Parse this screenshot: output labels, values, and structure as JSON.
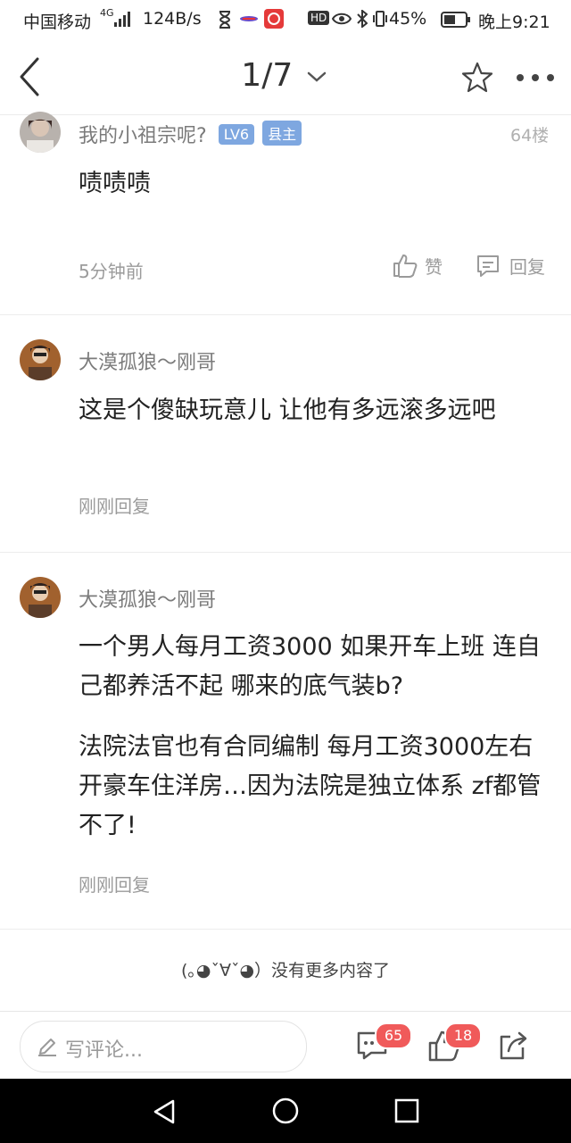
{
  "status_bar": {
    "carrier": "中国移动",
    "network_type": "4G",
    "speed": "124B/s",
    "battery_percent": "45%",
    "time": "晚上9:21",
    "hd_label": "HD"
  },
  "header": {
    "page_indicator": "1/7"
  },
  "posts": [
    {
      "username": "我的小祖宗呢?",
      "level_tag": "LV6",
      "role_tag": "县主",
      "floor": "64楼",
      "content": "啧啧啧",
      "time": "5分钟前",
      "like_label": "赞",
      "reply_label": "回复"
    },
    {
      "username": "大漠孤狼～刚哥",
      "content": "这是个傻缺玩意儿 让他有多远滚多远吧",
      "time": "刚刚回复"
    },
    {
      "username": "大漠孤狼～刚哥",
      "content": "一个男人每月工资3000 如果开车上班 连自己都养活不起 哪来的底气装b?",
      "content2": "法院法官也有合同编制 每月工资3000左右开豪车住洋房…因为法院是独立体系 zf都管不了!",
      "time": "刚刚回复"
    }
  ],
  "end_text": "(｡◕ˇ∀ˇ◕）没有更多内容了",
  "bottom_bar": {
    "comment_placeholder": "写评论...",
    "comment_count": "65",
    "like_count": "18"
  },
  "colors": {
    "tag_blue": "#7ea7e0",
    "badge_red": "#f05a5a"
  }
}
